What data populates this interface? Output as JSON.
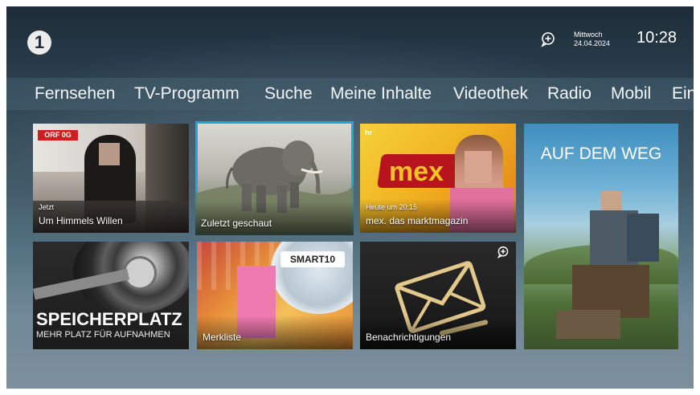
{
  "header": {
    "logo_text": "1",
    "weekday": "Mittwoch",
    "date": "24.04.2024",
    "time": "10:28"
  },
  "nav": {
    "items": [
      "Fernsehen",
      "TV-Programm",
      "Suche",
      "Meine Inhalte",
      "Videothek",
      "Radio",
      "Mobil",
      "Eins"
    ]
  },
  "tiles": {
    "himmel": {
      "badge": "ORF 0G",
      "sub": "Jetzt",
      "label": "Um Himmels Willen"
    },
    "zuletzt": {
      "label": "Zuletzt geschaut"
    },
    "mex": {
      "channel": "hr",
      "logo": "mex",
      "sub": "Heute um 20:15",
      "label": "mex. das marktmagazin"
    },
    "weg": {
      "title": "AUF DEM WEG"
    },
    "speicher": {
      "title": "SPEICHERPLATZ",
      "sub": "MEHR PLATZ FÜR AUFNAHMEN"
    },
    "merkliste": {
      "badge": "SMART10",
      "label": "Merkliste"
    },
    "benach": {
      "label": "Benachrichtigungen"
    }
  },
  "colors": {
    "focus": "#21a6d8",
    "text": "#ffffff"
  }
}
